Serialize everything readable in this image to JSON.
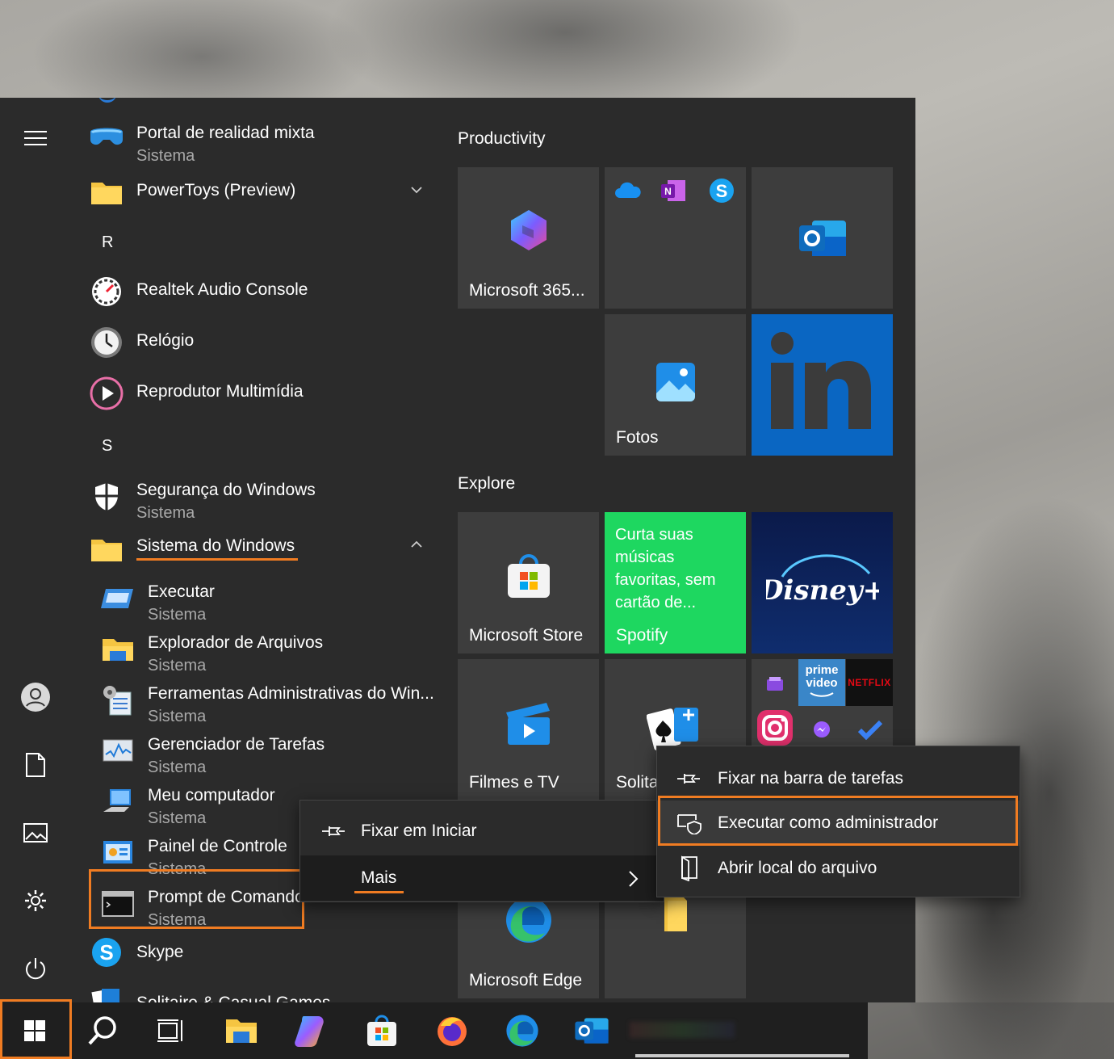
{
  "start_menu": {
    "app_list": {
      "items": [
        {
          "name": "Portal de realidad mixta",
          "sub": "Sistema"
        },
        {
          "name": "PowerToys (Preview)"
        },
        {
          "letter": "R"
        },
        {
          "name": "Realtek Audio Console"
        },
        {
          "name": "Relógio"
        },
        {
          "name": "Reprodutor Multimídia"
        },
        {
          "letter": "S"
        },
        {
          "name": "Segurança do Windows",
          "sub": "Sistema"
        },
        {
          "name": "Sistema do Windows"
        },
        {
          "name": "Executar",
          "sub": "Sistema"
        },
        {
          "name": "Explorador de Arquivos",
          "sub": "Sistema"
        },
        {
          "name": "Ferramentas Administrativas do Win...",
          "sub": "Sistema"
        },
        {
          "name": "Gerenciador de Tarefas",
          "sub": "Sistema"
        },
        {
          "name": "Meu computador",
          "sub": "Sistema"
        },
        {
          "name": "Painel de Controle",
          "sub": "Sistema"
        },
        {
          "name": "Prompt de Comando",
          "sub": "Sistema"
        },
        {
          "name": "Skype"
        },
        {
          "name": "Solitaire & Casual Games"
        }
      ]
    },
    "groups": {
      "productivity": "Productivity",
      "explore": "Explore"
    },
    "tiles": {
      "m365": "Microsoft 365...",
      "fotos": "Fotos",
      "store": "Microsoft Store",
      "spotify_text": "Curta suas músicas favoritas, sem cartão de...",
      "spotify": "Spotify",
      "filmes": "Filmes e TV",
      "solitaire": "Solita",
      "edge": "Microsoft Edge",
      "prime_top": "prime",
      "prime_bottom": "video",
      "netflix": "NETFLIX",
      "disney": "Disney+"
    }
  },
  "context_menu": {
    "pin_start": "Fixar em Iniciar",
    "more": "Mais"
  },
  "submenu": {
    "pin_taskbar": "Fixar na barra de tarefas",
    "run_admin": "Executar como administrador",
    "open_location": "Abrir local do arquivo"
  },
  "colors": {
    "highlight": "#f07c22",
    "linkedin": "#0a66c2",
    "spotify": "#1ed760",
    "disney": "#0b1a4a"
  }
}
